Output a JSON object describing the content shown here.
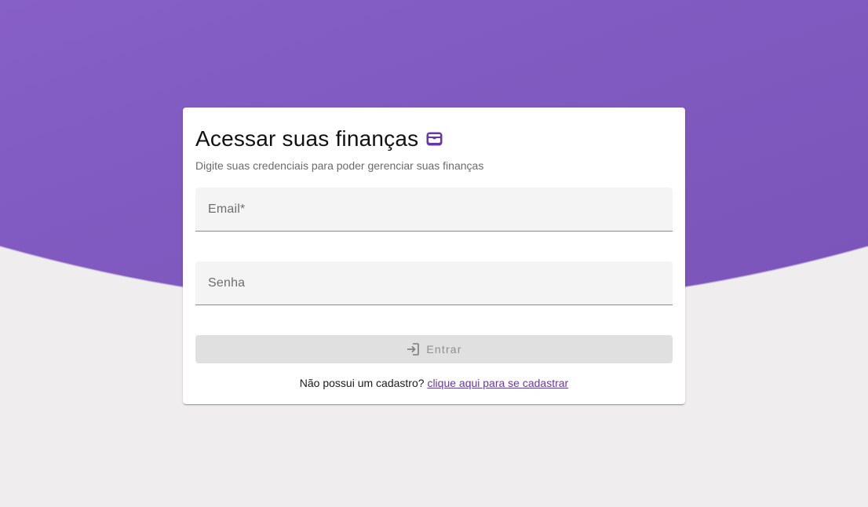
{
  "colors": {
    "brand": "#7e57c2",
    "link": "#6a35a8",
    "background": "#efedee",
    "button_disabled": "#e0e0e0"
  },
  "card": {
    "title": "Acessar suas finanças",
    "title_icon": "wallet-icon",
    "subtitle": "Digite suas credenciais para poder gerenciar suas finanças"
  },
  "form": {
    "email": {
      "label": "Email*",
      "value": ""
    },
    "password": {
      "label": "Senha",
      "value": ""
    },
    "submit": {
      "label": "Entrar",
      "icon": "login-icon",
      "disabled": true
    }
  },
  "footer": {
    "prompt": "Não possui um cadastro?",
    "link_label": "clique aqui para se cadastrar"
  }
}
